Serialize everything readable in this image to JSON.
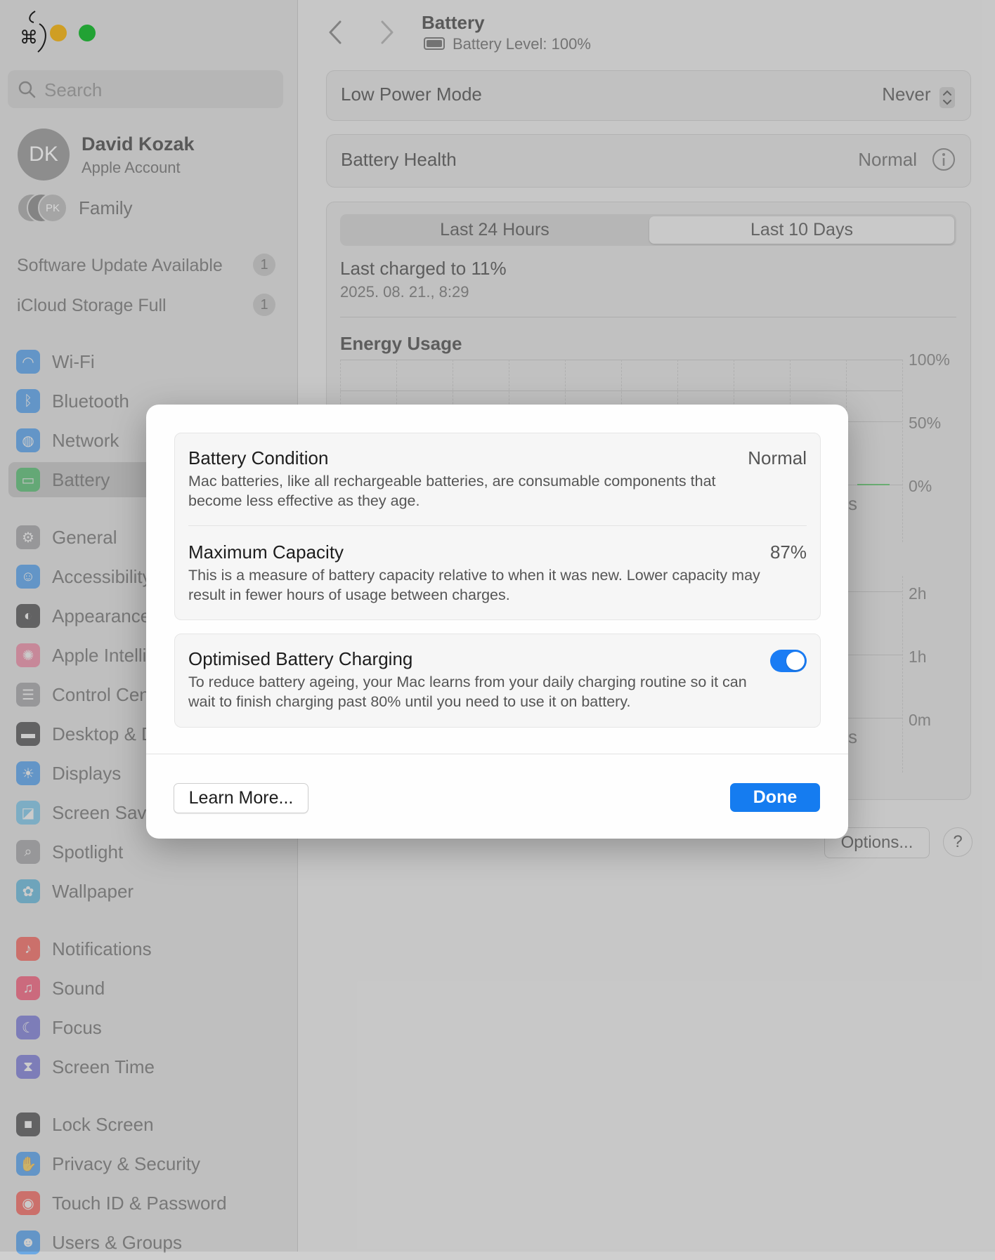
{
  "sidebar": {
    "search_placeholder": "Search",
    "account": {
      "initials": "DK",
      "name": "David Kozak",
      "subtitle": "Apple Account"
    },
    "family": {
      "avatar_initials": "PK",
      "label": "Family"
    },
    "alerts": [
      {
        "label": "Software Update Available",
        "count": "1"
      },
      {
        "label": "iCloud Storage Full",
        "count": "1"
      }
    ],
    "items": [
      {
        "label": "Wi-Fi",
        "icon": "wifi-icon",
        "color": "#1e8bf6"
      },
      {
        "label": "Bluetooth",
        "icon": "bluetooth-icon",
        "color": "#1e8bf6"
      },
      {
        "label": "Network",
        "icon": "globe-icon",
        "color": "#1e8bf6"
      },
      {
        "label": "Battery",
        "icon": "battery-icon",
        "color": "#34c759",
        "active": true
      },
      {
        "label": "General",
        "icon": "gear-icon",
        "color": "#8e8e93"
      },
      {
        "label": "Accessibility",
        "icon": "accessibility-icon",
        "color": "#1e8bf6"
      },
      {
        "label": "Appearance",
        "icon": "appearance-icon",
        "color": "#1c1c1e"
      },
      {
        "label": "Apple Intelligence & Siri",
        "icon": "apple-intelligence-icon",
        "color": "#f56f94"
      },
      {
        "label": "Control Centre",
        "icon": "control-centre-icon",
        "color": "#8e8e93"
      },
      {
        "label": "Desktop & Dock",
        "icon": "desktop-dock-icon",
        "color": "#1c1c1e"
      },
      {
        "label": "Displays",
        "icon": "displays-icon",
        "color": "#1e8bf6"
      },
      {
        "label": "Screen Saver",
        "icon": "screen-saver-icon",
        "color": "#55bef0"
      },
      {
        "label": "Spotlight",
        "icon": "spotlight-icon",
        "color": "#8e8e93"
      },
      {
        "label": "Wallpaper",
        "icon": "wallpaper-icon",
        "color": "#35aadc"
      },
      {
        "label": "Notifications",
        "icon": "notifications-icon",
        "color": "#ff3b30"
      },
      {
        "label": "Sound",
        "icon": "sound-icon",
        "color": "#ff2d55"
      },
      {
        "label": "Focus",
        "icon": "focus-icon",
        "color": "#5856d6"
      },
      {
        "label": "Screen Time",
        "icon": "screen-time-icon",
        "color": "#5856d6"
      },
      {
        "label": "Lock Screen",
        "icon": "lock-icon",
        "color": "#1c1c1e"
      },
      {
        "label": "Privacy & Security",
        "icon": "hand-icon",
        "color": "#1e8bf6"
      },
      {
        "label": "Touch ID & Password",
        "icon": "fingerprint-icon",
        "color": "#ff3b30"
      },
      {
        "label": "Users & Groups",
        "icon": "users-icon",
        "color": "#1e8bf6"
      }
    ]
  },
  "header": {
    "title": "Battery",
    "subtitle": "Battery Level: 100%"
  },
  "main": {
    "low_power_mode": {
      "label": "Low Power Mode",
      "value": "Never"
    },
    "battery_health": {
      "label": "Battery Health",
      "value": "Normal"
    },
    "tabs": [
      {
        "label": "Last 24 Hours"
      },
      {
        "label": "Last 10 Days",
        "selected": true
      }
    ],
    "last_charged": {
      "title": "Last charged to 11%",
      "date": "2025. 08. 21., 8:29"
    },
    "energy_usage": {
      "title": "Energy Usage",
      "y_ticks": [
        "100%",
        "50%",
        "0%"
      ],
      "x_fragment": "s"
    },
    "screen_on": {
      "y_ticks": [
        "2h",
        "1h",
        "0m"
      ],
      "x_fragment": "s"
    },
    "options_button": "Options...",
    "help_button": "?"
  },
  "modal": {
    "battery_condition": {
      "title": "Battery Condition",
      "value": "Normal",
      "description": "Mac batteries, like all rechargeable batteries, are consumable components that become less effective as they age."
    },
    "maximum_capacity": {
      "title": "Maximum Capacity",
      "value": "87%",
      "description": "This is a measure of battery capacity relative to when it was new. Lower capacity may result in fewer hours of usage between charges."
    },
    "optimised_charging": {
      "title": "Optimised Battery Charging",
      "enabled": true,
      "description": "To reduce battery ageing, your Mac learns from your daily charging routine so it can wait to finish charging past 80% until you need to use it on battery."
    },
    "learn_more_button": "Learn More...",
    "done_button": "Done"
  },
  "colors": {
    "accent": "#157cf0",
    "toggle_on": "#1a7cf4"
  }
}
